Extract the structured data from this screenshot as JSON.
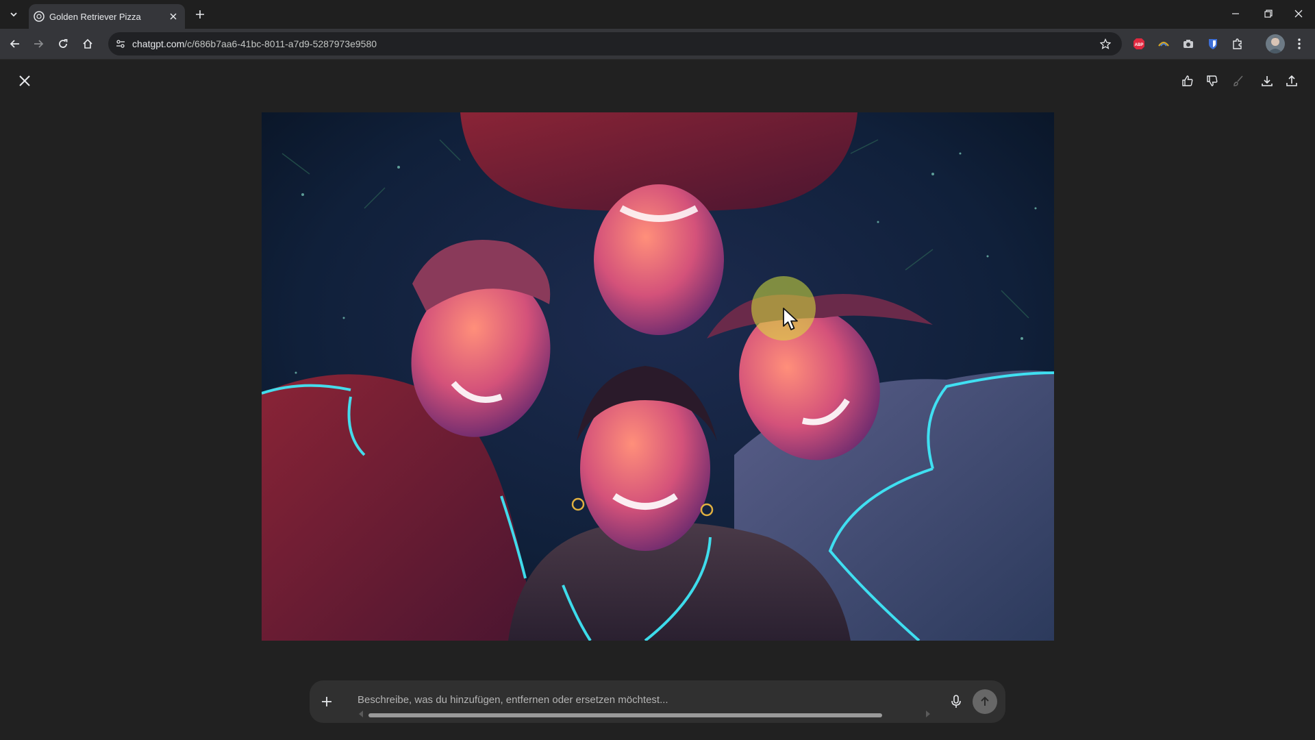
{
  "browser": {
    "tab": {
      "title": "Golden Retriever Pizza",
      "favicon": "chatgpt-logo-icon"
    },
    "url": {
      "host": "chatgpt.com",
      "path": "/c/686b7aa6-41bc-8011-a7d9-5287973e9580"
    },
    "extensions": [
      "adblock-plus-icon",
      "extension-icon",
      "camera-icon",
      "bitwarden-icon",
      "puzzle-icon"
    ]
  },
  "viewer": {
    "actions": [
      "thumbs-up-icon",
      "thumbs-down-icon",
      "edit-brush-icon",
      "download-icon",
      "share-icon"
    ],
    "image": {
      "subject": "four smiling friends lying head to head in grass, neon outlines"
    }
  },
  "prompt": {
    "placeholder": "Beschreibe, was du hinzufügen, entfernen oder ersetzen möchtest...",
    "value": ""
  },
  "colors": {
    "page_bg": "#212121",
    "toolbar_bg": "#35363a",
    "prompt_bg": "#303030",
    "neon": "#3ff0ff",
    "cursor_highlight": "#d7e13c"
  }
}
